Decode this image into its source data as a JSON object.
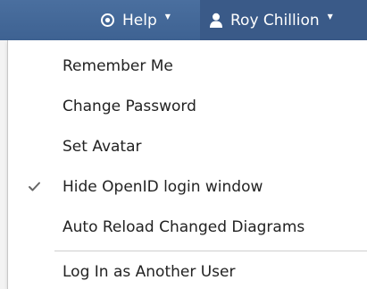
{
  "header": {
    "help_label": "Help",
    "user_label": "Roy Chillion"
  },
  "menu": {
    "items": [
      {
        "label": "Remember Me",
        "checked": false
      },
      {
        "label": "Change Password",
        "checked": false
      },
      {
        "label": "Set Avatar",
        "checked": false
      },
      {
        "label": "Hide OpenID login window",
        "checked": true
      },
      {
        "label": "Auto Reload Changed Diagrams",
        "checked": false
      }
    ],
    "footer_item": {
      "label": "Log In as Another User"
    }
  },
  "colors": {
    "topbar": "#3e6292",
    "active_tab": "#3a5a88",
    "menu_bg": "#ffffff",
    "text": "#222222",
    "check": "#666666"
  },
  "icons": {
    "help": "eye-circle-icon",
    "user": "user-icon",
    "dropdown": "caret-down-icon",
    "checked": "checkmark-icon"
  }
}
